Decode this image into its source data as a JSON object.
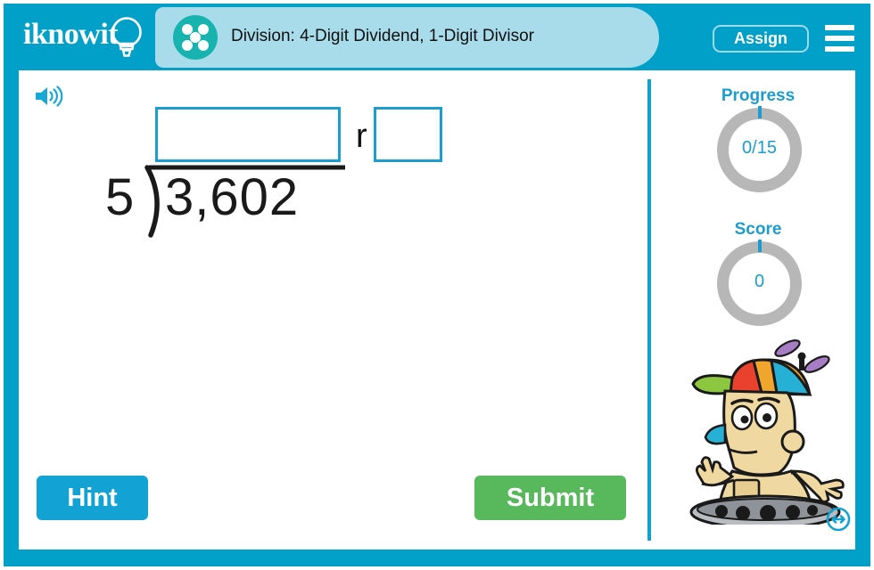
{
  "header": {
    "logo_text": "iknowit",
    "logo_icon": "lightbulb-icon",
    "topic_icon": "five-dots-circle-icon",
    "title": "Division: 4-Digit Dividend, 1-Digit Divisor",
    "assign_label": "Assign",
    "menu_icon": "hamburger-menu-icon",
    "bar_color": "#00a0c8",
    "title_band_color": "#a8dcea"
  },
  "content": {
    "audio_icon": "speaker-icon"
  },
  "problem": {
    "divisor": "5",
    "dividend": "3,602",
    "quotient_value": "",
    "quotient_placeholder": "",
    "remainder_label": "r",
    "remainder_value": "",
    "remainder_placeholder": "",
    "input_border_color": "#1b9dd0"
  },
  "stats": {
    "progress_label": "Progress",
    "progress_value": "0/15",
    "score_label": "Score",
    "score_value": "0",
    "ring_color": "#b7b7b7",
    "accent_color": "#1b9dd0"
  },
  "mascot": {
    "name": "robot-mascot",
    "resize_icon": "resize-horizontal-icon"
  },
  "actions": {
    "hint_label": "Hint",
    "hint_color": "#12a2d4",
    "submit_label": "Submit",
    "submit_color": "#57b85c"
  }
}
